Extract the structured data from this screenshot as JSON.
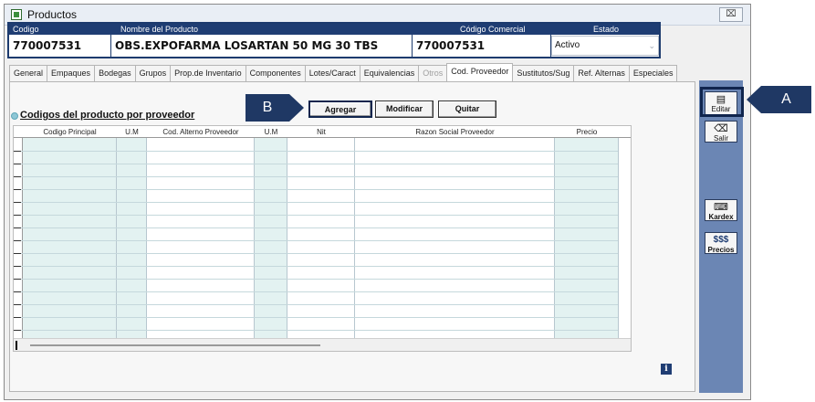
{
  "window": {
    "title": "Productos",
    "close_glyph": "⌧"
  },
  "header": {
    "labels": {
      "codigo": "Codigo",
      "nombre": "Nombre del Producto",
      "codigo_comercial": "Código Comercial",
      "estado": "Estado"
    },
    "values": {
      "codigo": "770007531",
      "nombre": "OBS.EXPOFARMA LOSARTAN 50 MG 30 TBS",
      "codigo_comercial": "770007531",
      "estado": "Activo"
    }
  },
  "tabs": [
    {
      "label": "General"
    },
    {
      "label": "Empaques"
    },
    {
      "label": "Bodegas"
    },
    {
      "label": "Grupos"
    },
    {
      "label": "Prop.de Inventario"
    },
    {
      "label": "Componentes"
    },
    {
      "label": "Lotes/Caract"
    },
    {
      "label": "Equivalencias"
    },
    {
      "label": "Otros"
    },
    {
      "label": "Cod. Proveedor"
    },
    {
      "label": "Sustitutos/Sug"
    },
    {
      "label": "Ref. Alternas"
    },
    {
      "label": "Especiales"
    }
  ],
  "active_tab": "Cod. Proveedor",
  "section": {
    "title": "Codigos del producto por proveedor"
  },
  "actions": {
    "agregar": "Agregar",
    "modificar": "Modificar",
    "quitar": "Quitar"
  },
  "grid": {
    "columns": [
      "Codigo Principal",
      "U.M",
      "Cod. Alterno  Proveedor",
      "U.M",
      "Nit",
      "Razon Social Proveedor",
      "Precio"
    ],
    "rows": []
  },
  "sidebar": {
    "editar": "Editar",
    "salir": "Salir",
    "kardex": "Kardex",
    "precios_symbol": "$$$",
    "precios": "Precios"
  },
  "callouts": {
    "a": "A",
    "b": "B"
  },
  "info_glyph": "i",
  "colors": {
    "header_bar": "#1f3d73",
    "sidebar": "#6b86b4",
    "grid_tint": "#e3f2f1",
    "callout": "#1f3864"
  }
}
